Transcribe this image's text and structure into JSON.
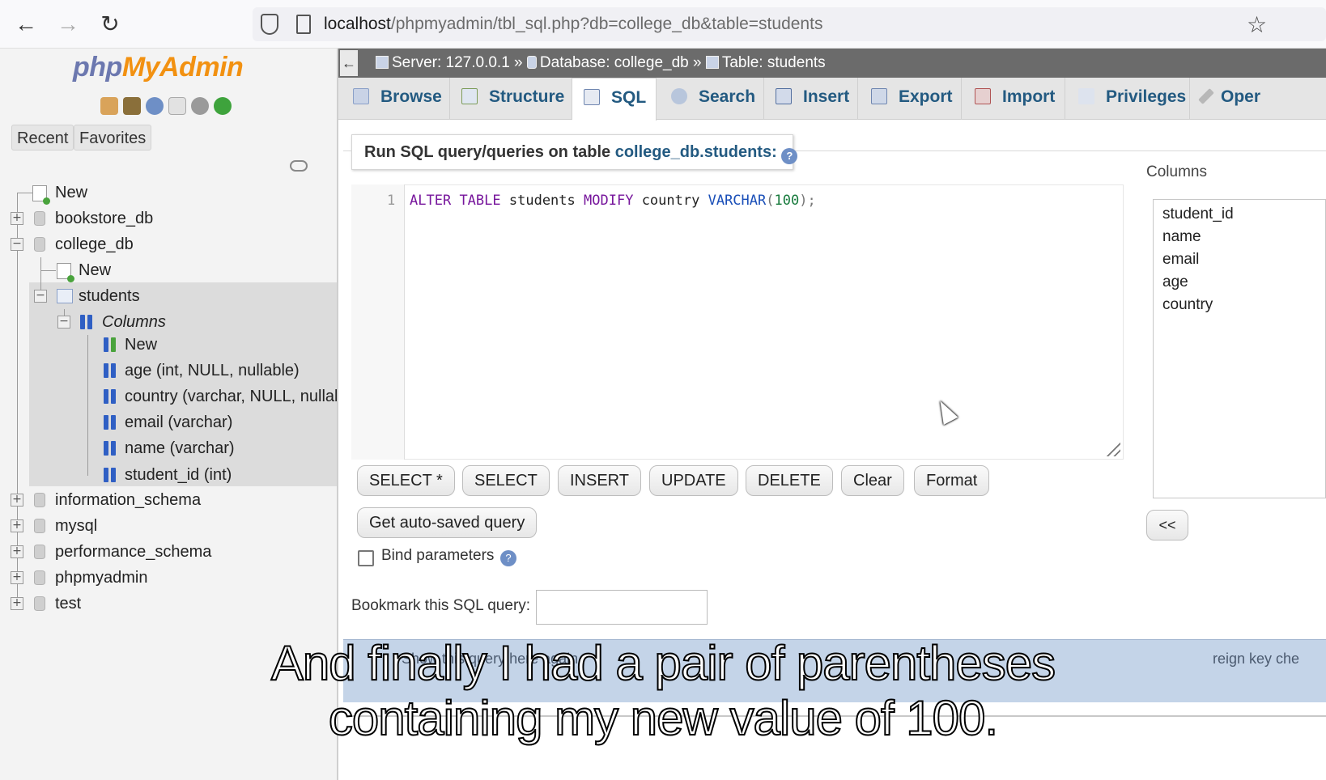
{
  "browser": {
    "url_host": "localhost",
    "url_path": "/phpmyadmin/tbl_sql.php?db=college_db&table=students"
  },
  "nav": {
    "logo_php": "php",
    "logo_myadmin": "MyAdmin",
    "recent_label": "Recent",
    "favorites_label": "Favorites",
    "tree": {
      "new": "New",
      "bookstore_db": "bookstore_db",
      "college_db": "college_db",
      "college_new": "New",
      "students": "students",
      "columns": "Columns",
      "columns_new": "New",
      "col_age": "age (int, NULL, nullable)",
      "col_country": "country (varchar, NULL, nullable)",
      "col_email": "email (varchar)",
      "col_name": "name (varchar)",
      "col_student_id": "student_id (int)",
      "information_schema": "information_schema",
      "mysql": "mysql",
      "performance_schema": "performance_schema",
      "phpmyadmin": "phpmyadmin",
      "test": "test"
    }
  },
  "breadcrumb": {
    "server": "Server: 127.0.0.1",
    "database": "Database: college_db",
    "table": "Table: students",
    "separator": "»"
  },
  "tabs": {
    "browse": "Browse",
    "structure": "Structure",
    "sql": "SQL",
    "search": "Search",
    "insert": "Insert",
    "export": "Export",
    "import": "Import",
    "privileges": "Privileges",
    "operations": "Oper"
  },
  "query": {
    "legend_prefix": "Run SQL query/queries on table",
    "legend_table": "college_db.students:",
    "line_number": "1",
    "code": {
      "alter": "ALTER",
      "table_kw": "TABLE",
      "table_name": "students",
      "modify": "MODIFY",
      "column": "country",
      "type": "VARCHAR",
      "open": "(",
      "length": "100",
      "close": ");"
    }
  },
  "buttons": {
    "select_star": "SELECT *",
    "select": "SELECT",
    "insert": "INSERT",
    "update": "UPDATE",
    "delete": "DELETE",
    "clear": "Clear",
    "format": "Format",
    "autosaved": "Get auto-saved query"
  },
  "bind_parameters": "Bind parameters",
  "bookmark_label": "Bookmark this SQL query:",
  "columns_panel": {
    "label": "Columns",
    "items": [
      "student_id",
      "name",
      "email",
      "age",
      "country"
    ],
    "insert_button": "<<"
  },
  "options": {
    "left_fragment": "Show this query here again",
    "right_fragment": "reign key che"
  },
  "subtitles": {
    "line1": "And finally I had a pair of parentheses",
    "line2": "containing my new value of 100."
  },
  "colors": {
    "link_blue": "#235a81",
    "breadcrumb_bg": "#6b6b6b",
    "logo_php": "#6c78af",
    "logo_myadmin": "#f29111",
    "column_icon": "#2f5fc4"
  }
}
